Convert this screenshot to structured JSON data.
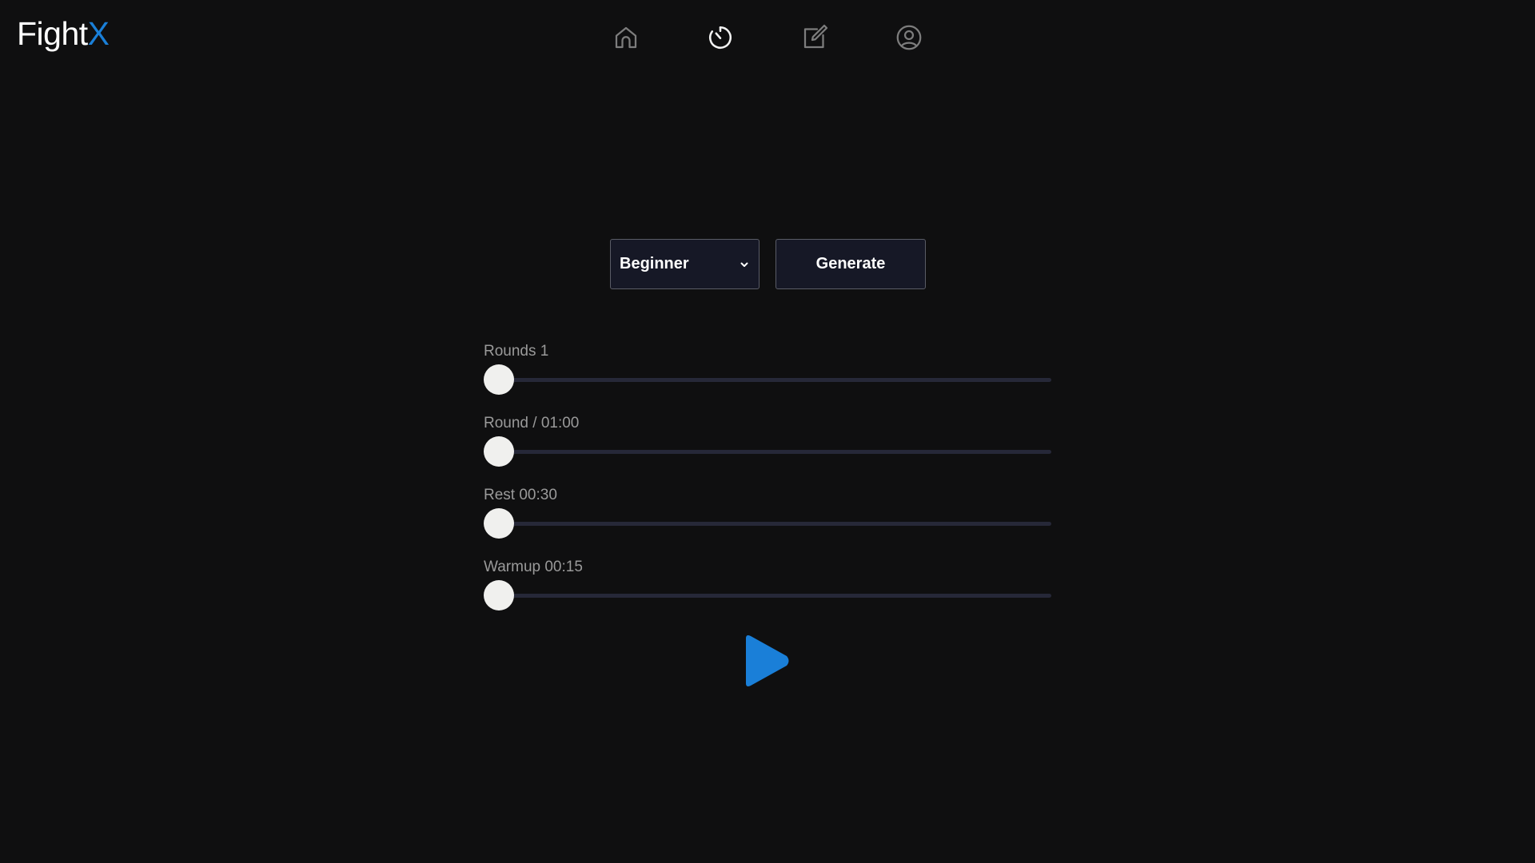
{
  "logo": {
    "main": "Fight",
    "accent": "X"
  },
  "nav": {
    "items": [
      {
        "name": "home",
        "icon": "home-icon",
        "active": false
      },
      {
        "name": "timer",
        "icon": "timer-icon",
        "active": true
      },
      {
        "name": "edit",
        "icon": "edit-icon",
        "active": false
      },
      {
        "name": "profile",
        "icon": "user-circle-icon",
        "active": false
      }
    ]
  },
  "controls": {
    "level": {
      "selected": "Beginner"
    },
    "generate_label": "Generate"
  },
  "sliders": [
    {
      "label": "Rounds 1",
      "value": 0
    },
    {
      "label": "Round / 01:00",
      "value": 0
    },
    {
      "label": "Rest 00:30",
      "value": 0
    },
    {
      "label": "Warmup 00:15",
      "value": 0
    }
  ],
  "play": {
    "icon": "play-icon"
  },
  "colors": {
    "background": "#0f0f10",
    "accent": "#1a7fd8",
    "button_bg": "#161826",
    "track": "#262838",
    "thumb": "#f0f0ee"
  }
}
